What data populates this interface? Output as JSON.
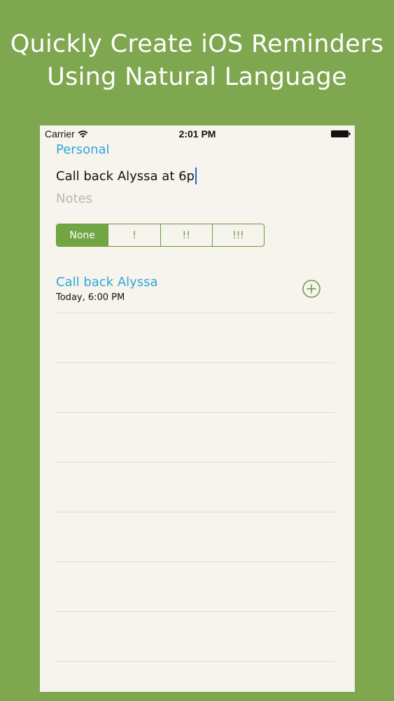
{
  "headline": {
    "line1": "Quickly Create iOS Reminders",
    "line2": "Using Natural Language"
  },
  "status_bar": {
    "carrier": "Carrier",
    "time": "2:01 PM",
    "wifi_icon": "wifi-icon",
    "battery_icon": "battery-icon"
  },
  "reminder": {
    "list_name": "Personal",
    "input_value": "Call back Alyssa at 6p",
    "notes_placeholder": "Notes"
  },
  "priority": {
    "options": [
      "None",
      "!",
      "!!",
      "!!!"
    ],
    "selected": "None"
  },
  "suggestion": {
    "title": "Call back Alyssa",
    "subtitle": "Today, 6:00 PM",
    "add_icon": "plus-circle-icon"
  },
  "colors": {
    "background": "#7ea74f",
    "accent_green": "#72a645",
    "link_blue": "#2fa6de",
    "paper": "#f6f4ed"
  }
}
